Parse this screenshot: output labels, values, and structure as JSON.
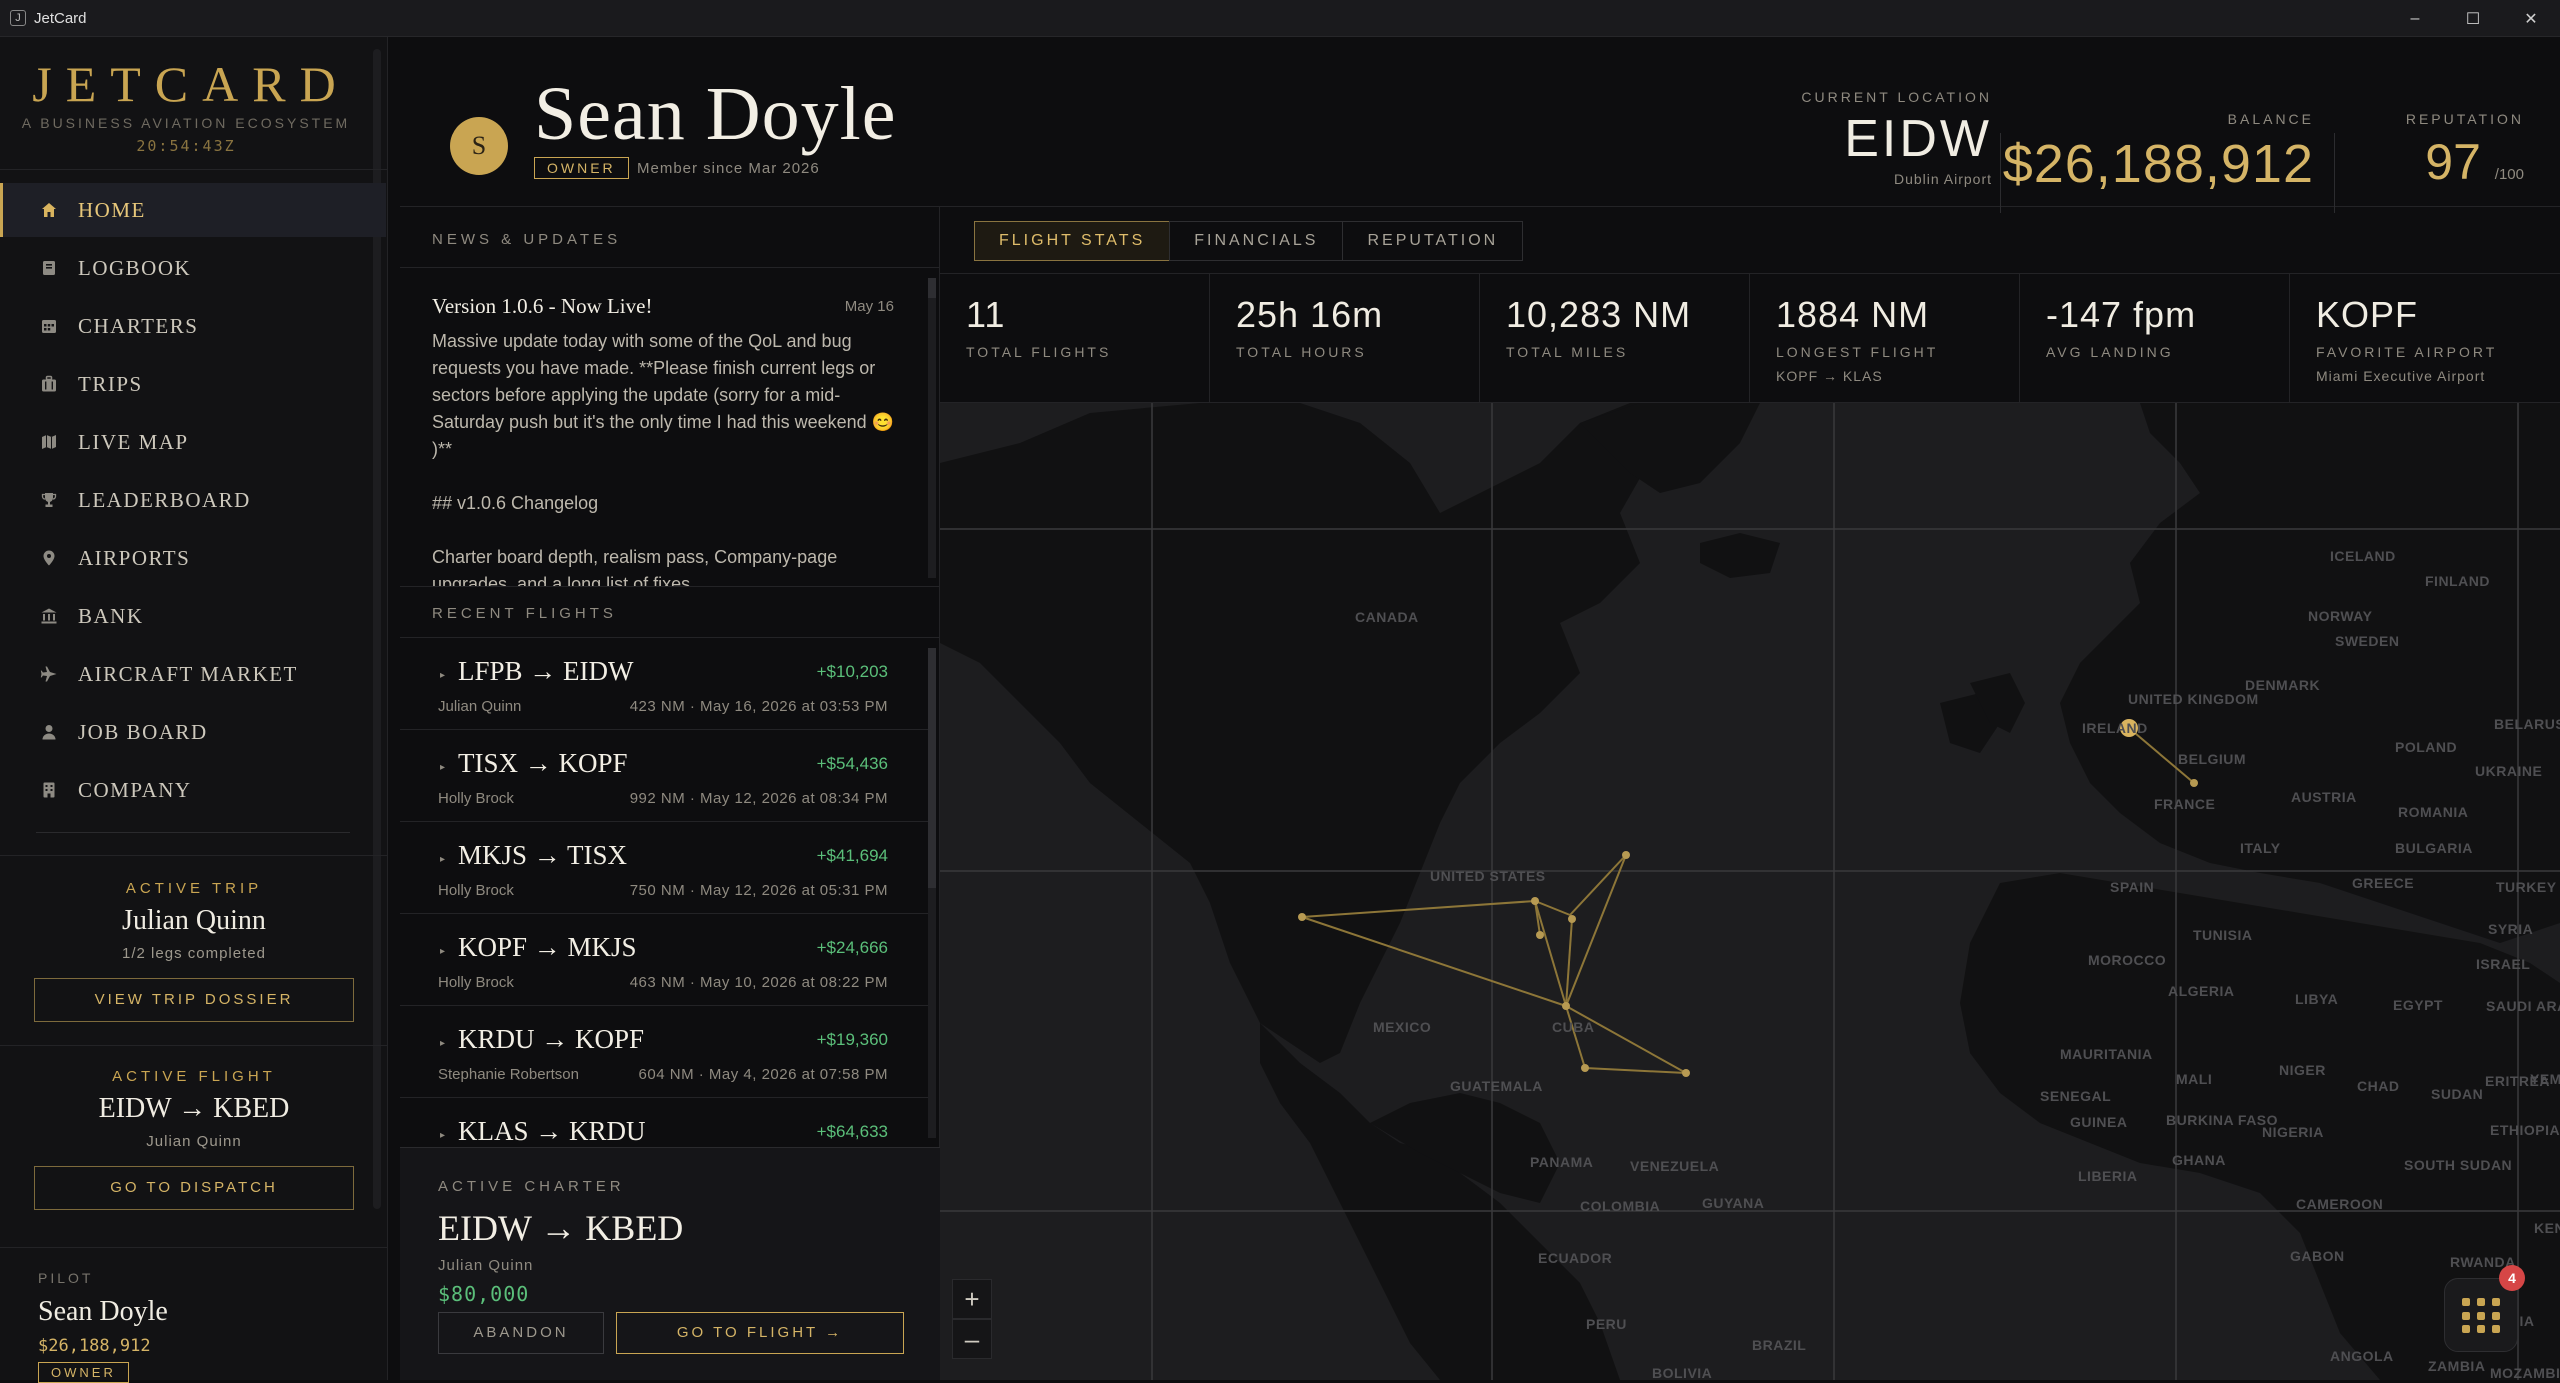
{
  "window": {
    "title": "JetCard",
    "app_icon": "J",
    "minimize": "–",
    "maximize": "☐",
    "close": "✕"
  },
  "brand": {
    "logo": "JETCARD",
    "tagline": "A BUSINESS AVIATION ECOSYSTEM",
    "clock": "20:54:43Z"
  },
  "nav": {
    "items": [
      {
        "label": "HOME",
        "icon": "home-icon"
      },
      {
        "label": "LOGBOOK",
        "icon": "book-icon"
      },
      {
        "label": "CHARTERS",
        "icon": "calendar-icon"
      },
      {
        "label": "TRIPS",
        "icon": "luggage-icon"
      },
      {
        "label": "LIVE MAP",
        "icon": "map-icon"
      },
      {
        "label": "LEADERBOARD",
        "icon": "trophy-icon"
      },
      {
        "label": "AIRPORTS",
        "icon": "pin-icon"
      },
      {
        "label": "BANK",
        "icon": "bank-icon"
      },
      {
        "label": "AIRCRAFT MARKET",
        "icon": "plane-icon"
      },
      {
        "label": "JOB BOARD",
        "icon": "person-icon"
      },
      {
        "label": "COMPANY",
        "icon": "building-icon"
      }
    ],
    "active": "HOME"
  },
  "active_trip": {
    "kicker": "ACTIVE TRIP",
    "name": "Julian Quinn",
    "progress": "1/2 legs completed",
    "button": "VIEW TRIP DOSSIER"
  },
  "active_flight": {
    "kicker": "ACTIVE FLIGHT",
    "route": "EIDW → KBED",
    "pilot": "Julian Quinn",
    "button": "GO TO DISPATCH"
  },
  "pilot": {
    "kicker": "PILOT",
    "name": "Sean Doyle",
    "balance": "$26,188,912",
    "role": "OWNER"
  },
  "profile": {
    "initial": "S",
    "name": "Sean Doyle",
    "role": "OWNER",
    "member_since": "Member since Mar 2026",
    "location_label": "CURRENT LOCATION",
    "location_code": "EIDW",
    "location_name": "Dublin Airport",
    "balance_label": "BALANCE",
    "balance": "$26,188,912",
    "reputation_label": "REPUTATION",
    "reputation": "97",
    "reputation_max": "/100"
  },
  "news": {
    "section_title": "NEWS & UPDATES",
    "title": "Version 1.0.6 - Now Live!",
    "date": "May 16",
    "body": "Massive update today with some of the QoL and bug requests you have made. **Please finish current legs or sectors before applying the update (sorry for a mid-Saturday push but it's the only time I had this weekend 😊 )**\n\n## v1.0.6 Changelog\n\nCharter board depth, realism pass, Company-page upgrades, and a long list of fixes."
  },
  "recent_flights": {
    "section_title": "RECENT FLIGHTS",
    "items": [
      {
        "route": "LFPB → EIDW",
        "amount": "+$10,203",
        "pilot": "Julian Quinn",
        "meta": "423 NM · May 16, 2026 at 03:53 PM"
      },
      {
        "route": "TISX → KOPF",
        "amount": "+$54,436",
        "pilot": "Holly Brock",
        "meta": "992 NM · May 12, 2026 at 08:34 PM"
      },
      {
        "route": "MKJS → TISX",
        "amount": "+$41,694",
        "pilot": "Holly Brock",
        "meta": "750 NM · May 12, 2026 at 05:31 PM"
      },
      {
        "route": "KOPF → MKJS",
        "amount": "+$24,666",
        "pilot": "Holly Brock",
        "meta": "463 NM · May 10, 2026 at 08:22 PM"
      },
      {
        "route": "KRDU → KOPF",
        "amount": "+$19,360",
        "pilot": "Stephanie Robertson",
        "meta": "604 NM · May 4, 2026 at 07:58 PM"
      },
      {
        "route": "KLAS → KRDU",
        "amount": "+$64,633",
        "pilot": "",
        "meta": ""
      }
    ]
  },
  "active_charter": {
    "kicker": "ACTIVE CHARTER",
    "route": "EIDW → KBED",
    "pilot": "Julian Quinn",
    "pay": "$80,000",
    "abandon": "ABANDON",
    "go": "GO TO FLIGHT →"
  },
  "tabs": [
    {
      "label": "FLIGHT STATS",
      "active": true
    },
    {
      "label": "FINANCIALS",
      "active": false
    },
    {
      "label": "REPUTATION",
      "active": false
    }
  ],
  "stats": [
    {
      "value": "11",
      "label": "TOTAL FLIGHTS",
      "sub": ""
    },
    {
      "value": "25h 16m",
      "label": "TOTAL HOURS",
      "sub": ""
    },
    {
      "value": "10,283 NM",
      "label": "TOTAL MILES",
      "sub": ""
    },
    {
      "value": "1884 NM",
      "label": "LONGEST FLIGHT",
      "sub": "KOPF → KLAS"
    },
    {
      "value": "-147 fpm",
      "label": "AVG LANDING",
      "sub": ""
    },
    {
      "value": "KOPF",
      "label": "FAVORITE AIRPORT",
      "sub": "Miami Executive Airport"
    }
  ],
  "map": {
    "labels": [
      "ICELAND",
      "FINLAND",
      "NORWAY",
      "SWEDEN",
      "CANADA",
      "UNITED KINGDOM",
      "DENMARK",
      "IRELAND",
      "BELARUS",
      "POLAND",
      "BELGIUM",
      "UKRAINE",
      "FRANCE",
      "AUSTRIA",
      "ROMANIA",
      "ITALY",
      "BULGARIA",
      "GREECE",
      "SPAIN",
      "TURKEY",
      "UNITED STATES",
      "TUNISIA",
      "SYRIA",
      "MOROCCO",
      "ISRAEL",
      "ALGERIA",
      "LIBYA",
      "EGYPT",
      "SAUDI ARABIA",
      "MEXICO",
      "CUBA",
      "MAURITANIA",
      "MALI",
      "NIGER",
      "CHAD",
      "SUDAN",
      "ERITREA",
      "YEMEN",
      "GUATEMALA",
      "SENEGAL",
      "GUINEA",
      "BURKINA FASO",
      "NIGERIA",
      "ETHIOPIA",
      "PANAMA",
      "VENEZUELA",
      "GHANA",
      "LIBERIA",
      "SOUTH SUDAN",
      "COLOMBIA",
      "GUYANA",
      "CAMEROON",
      "KENYA",
      "GABON",
      "ECUADOR",
      "RWANDA",
      "PERU",
      "TANZANIA",
      "BRAZIL",
      "ANGOLA",
      "ZAMBIA",
      "BOLIVIA",
      "MOZAMBIQUE"
    ],
    "zoom_in": "+",
    "zoom_out": "–",
    "notification_count": "4"
  },
  "colors": {
    "accent": "#c9a552",
    "positive": "#5bbf7a",
    "background": "#0d0d0f",
    "alert": "#d64646"
  }
}
